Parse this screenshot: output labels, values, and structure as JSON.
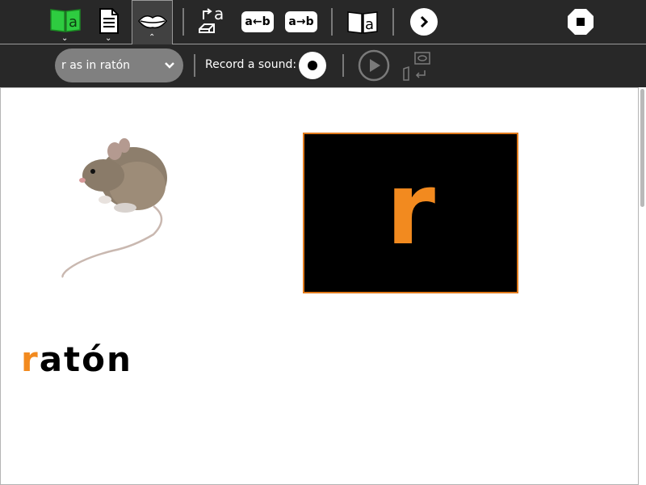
{
  "toolbar": {
    "icons": [
      "read-activity-icon",
      "document-icon",
      "lips-icon",
      "letter-insert-icon",
      "a-to-b-icon",
      "b-from-a-icon",
      "book-icon",
      "next-icon",
      "stop-icon"
    ],
    "ab_left": "a←b",
    "ab_right": "a→b",
    "insert_letter": "a",
    "book_letter": "a"
  },
  "subtoolbar": {
    "combo_value": "r as in ratón",
    "record_label": "Record a sound:"
  },
  "content": {
    "letter": "r",
    "word_highlight": "r",
    "word_rest": "atón"
  },
  "colors": {
    "accent": "#f28a1f",
    "active_green": "#2ecc40",
    "toolbar": "#282828"
  }
}
